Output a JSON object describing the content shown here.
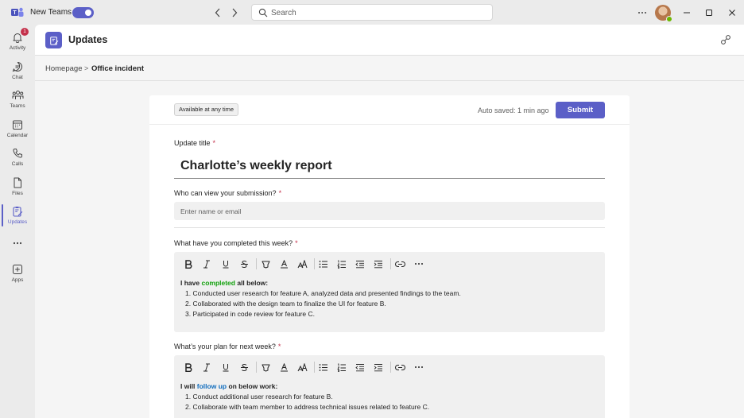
{
  "titlebar": {
    "app_name": "New Teams",
    "search_placeholder": "Search",
    "toggle_on": true
  },
  "rail": {
    "items": [
      {
        "label": "Activity",
        "icon": "bell-icon",
        "badge": "1"
      },
      {
        "label": "Chat",
        "icon": "chat-icon"
      },
      {
        "label": "Teams",
        "icon": "teams-icon"
      },
      {
        "label": "Calendar",
        "icon": "calendar-icon"
      },
      {
        "label": "Calls",
        "icon": "phone-icon"
      },
      {
        "label": "Files",
        "icon": "file-icon"
      },
      {
        "label": "Updates",
        "icon": "updates-icon",
        "active": true
      },
      {
        "label": "",
        "icon": "more-icon"
      },
      {
        "label": "Apps",
        "icon": "add-apps-icon"
      }
    ]
  },
  "header": {
    "title": "Updates"
  },
  "breadcrumb": {
    "home": "Homepage",
    "separator": ">",
    "current": "Office incident"
  },
  "form": {
    "availability": "Available at any time",
    "autosave": "Auto saved: 1 min ago",
    "submit_label": "Submit",
    "title_label": "Update title",
    "title_value": "Charlotte’s weekly report",
    "who_label": "Who can view your submission?",
    "who_placeholder": "Enter name or email",
    "completed_label": "What have you completed this week?",
    "completed": {
      "lead_before": "I have ",
      "lead_highlight": "completed",
      "lead_after": " all below:",
      "items": [
        "1. Conducted user research for feature A, analyzed data and presented findings to the team.",
        "2. Collaborated with the design team to finalize the UI for feature B.",
        "3. Participated in code review for feature C."
      ]
    },
    "plan_label": "What’s your plan for next week?",
    "plan": {
      "lead_before": "I will ",
      "lead_highlight": "follow up",
      "lead_after": " on below work:",
      "items": [
        "1. Conduct additional user research for feature B.",
        "2. Collaborate with team member to address technical issues related to feature C."
      ]
    },
    "required_mark": "*"
  },
  "colors": {
    "accent": "#5b5fc7",
    "required": "#c4314b",
    "highlight_green": "#13a10e",
    "highlight_blue": "#0f6cbd",
    "presence": "#6bb700"
  }
}
